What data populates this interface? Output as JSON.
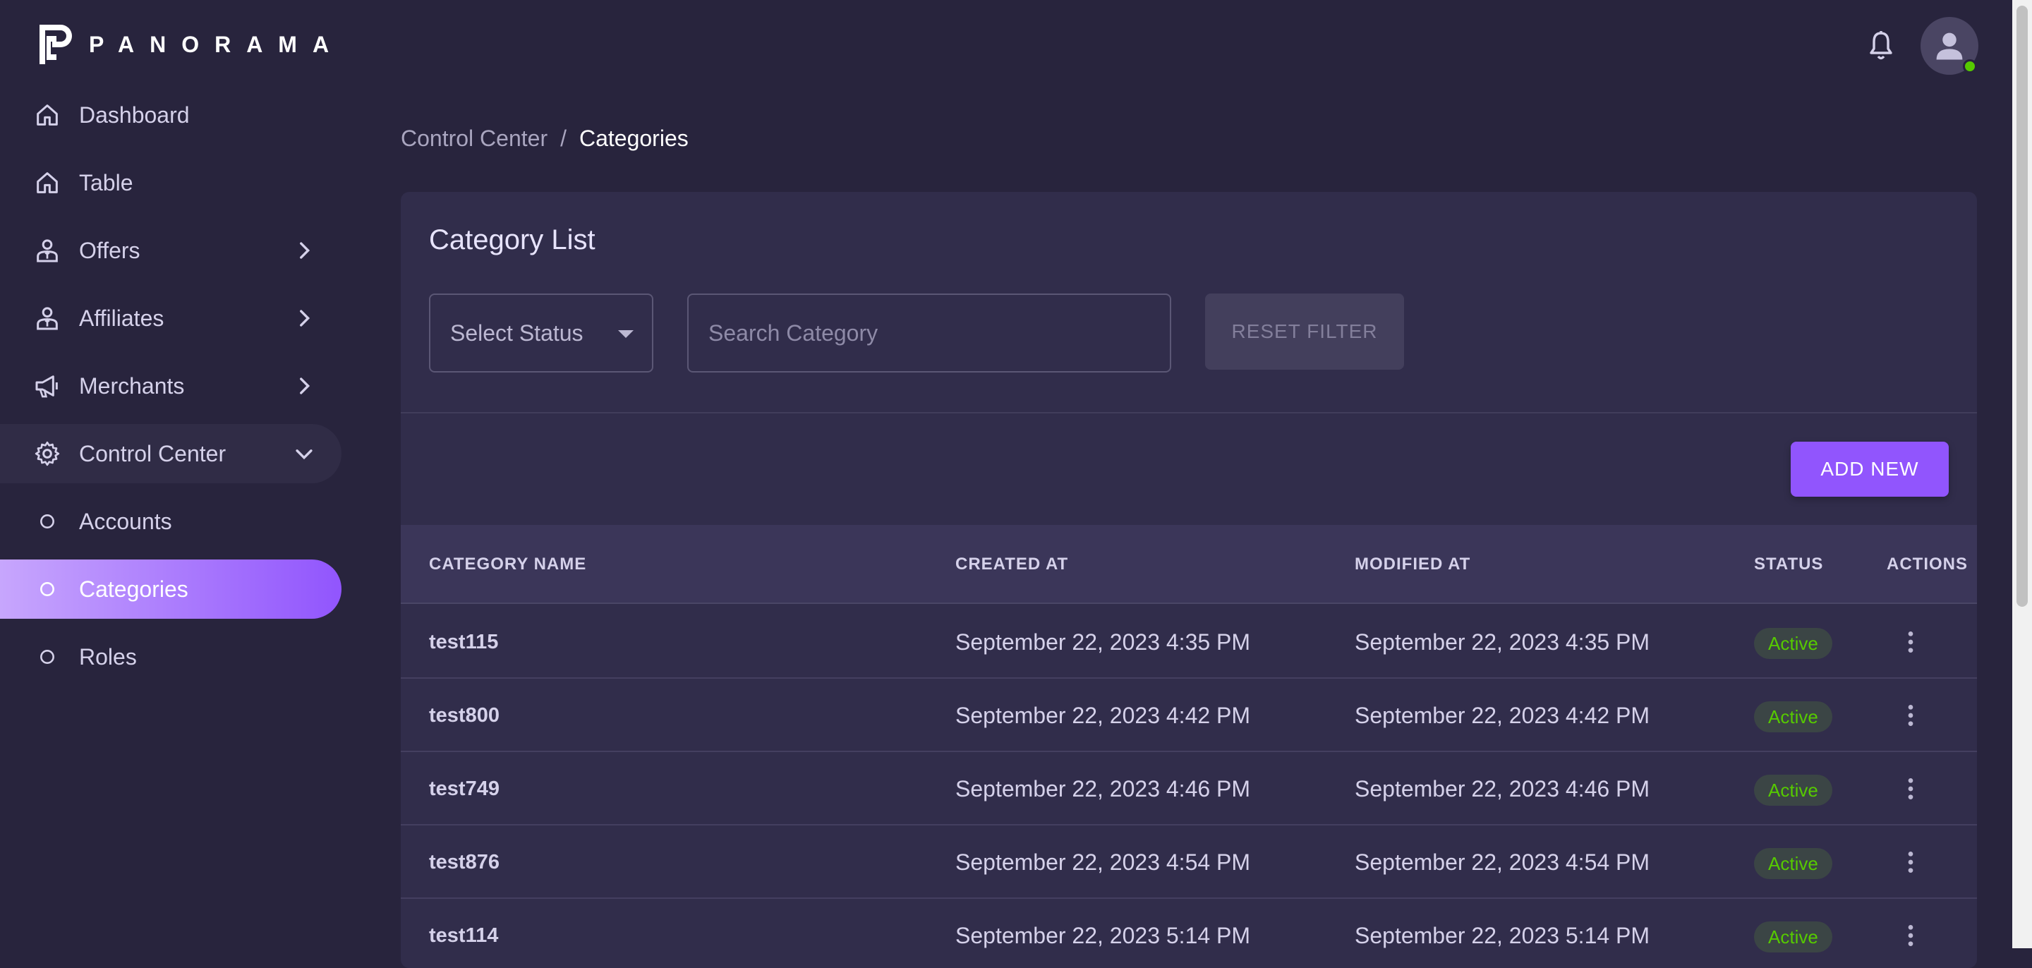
{
  "brand": {
    "name": "PANORAMA"
  },
  "sidebar": {
    "items": [
      {
        "label": "Dashboard",
        "icon": "home-icon"
      },
      {
        "label": "Table",
        "icon": "home-icon"
      },
      {
        "label": "Offers",
        "icon": "account-tie-icon",
        "expandable": true
      },
      {
        "label": "Affiliates",
        "icon": "account-tie-icon",
        "expandable": true
      },
      {
        "label": "Merchants",
        "icon": "bullhorn-icon",
        "expandable": true
      },
      {
        "label": "Control Center",
        "icon": "gear-icon",
        "expanded": true
      },
      {
        "label": "Accounts",
        "icon": "circle-outline-icon"
      },
      {
        "label": "Categories",
        "icon": "circle-outline-icon",
        "active": true
      },
      {
        "label": "Roles",
        "icon": "circle-outline-icon"
      }
    ]
  },
  "breadcrumb": {
    "parent": "Control Center",
    "separator": "/",
    "current": "Categories"
  },
  "card": {
    "title": "Category List",
    "status_select": {
      "value": "Select Status"
    },
    "search": {
      "placeholder": "Search Category"
    },
    "reset_label": "RESET FILTER",
    "add_label": "ADD NEW"
  },
  "table": {
    "columns": [
      "CATEGORY NAME",
      "CREATED AT",
      "MODIFIED AT",
      "STATUS",
      "ACTIONS"
    ],
    "rows": [
      {
        "name": "test115",
        "created": "September 22, 2023 4:35 PM",
        "modified": "September 22, 2023 4:35 PM",
        "status": "Active"
      },
      {
        "name": "test800",
        "created": "September 22, 2023 4:42 PM",
        "modified": "September 22, 2023 4:42 PM",
        "status": "Active"
      },
      {
        "name": "test749",
        "created": "September 22, 2023 4:46 PM",
        "modified": "September 22, 2023 4:46 PM",
        "status": "Active"
      },
      {
        "name": "test876",
        "created": "September 22, 2023 4:54 PM",
        "modified": "September 22, 2023 4:54 PM",
        "status": "Active"
      },
      {
        "name": "test114",
        "created": "September 22, 2023 5:14 PM",
        "modified": "September 22, 2023 5:14 PM",
        "status": "Active"
      }
    ]
  },
  "colors": {
    "background": "#28243d",
    "card": "#312d4b",
    "accent": "#9155fd",
    "status_active": "#56ca00"
  }
}
